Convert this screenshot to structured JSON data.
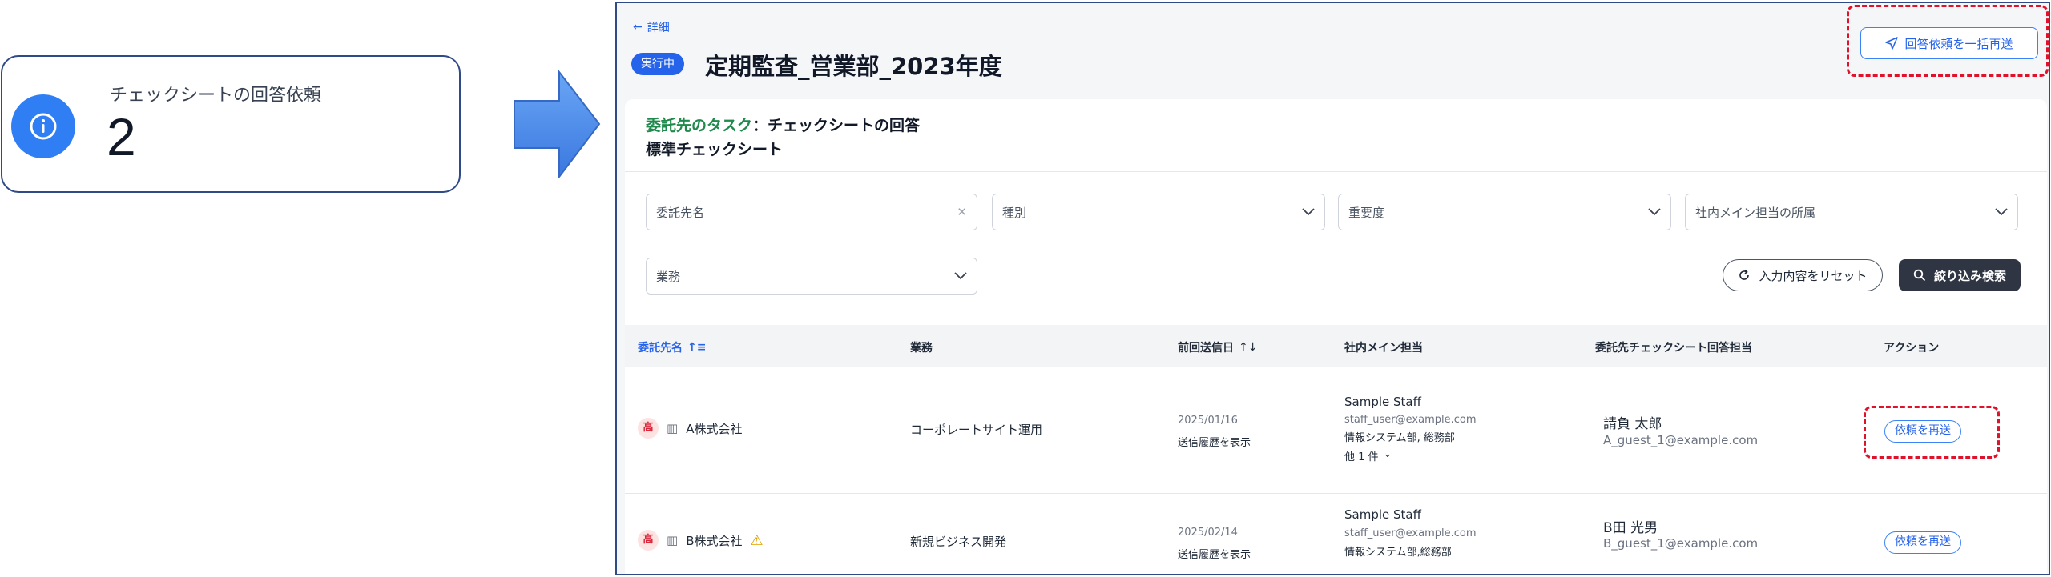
{
  "notice": {
    "label": "チェックシートの回答依頼",
    "count": "2",
    "icon": "info-icon"
  },
  "header": {
    "back_label": "詳細",
    "status": "実行中",
    "title": "定期監査_営業部_2023年度",
    "bulk_resend_label": "回答依頼を一括再送"
  },
  "task": {
    "prefix": "委託先のタスク",
    "separator": "：",
    "name": "チェックシートの回答",
    "checksheet": "標準チェックシート"
  },
  "filters": {
    "vendor_name": "委託先名",
    "type": "種別",
    "importance": "重要度",
    "department": "社内メイン担当の所属",
    "business": "業務"
  },
  "actions": {
    "reset_label": "入力内容をリセット",
    "search_label": "絞り込み検索"
  },
  "table": {
    "headers": {
      "vendor": "委託先名",
      "business": "業務",
      "last_sent": "前回送信日",
      "main_staff": "社内メイン担当",
      "respondent": "委託先チェックシート回答担当",
      "action": "アクション"
    },
    "rows": [
      {
        "priority": "高",
        "vendor": "A株式会社",
        "business": "コーポレートサイト運用",
        "last_sent": "2025/01/16",
        "history_link": "送信履歴を表示",
        "staff_name": "Sample Staff",
        "staff_email": "staff_user@example.com",
        "staff_dept": "情報システム部, 総務部",
        "staff_more": "他 1 件",
        "respondent_name": "請負 太郎",
        "respondent_email": "A_guest_1@example.com",
        "action_label": "依頼を再送"
      },
      {
        "priority": "高",
        "vendor": "B株式会社",
        "business": "新規ビジネス開発",
        "last_sent": "2025/02/14",
        "history_link": "送信履歴を表示",
        "staff_name": "Sample Staff",
        "staff_email": "staff_user@example.com",
        "staff_dept": "情報システム部,総務部",
        "respondent_name": "B田 光男",
        "respondent_email": "B_guest_1@example.com",
        "action_label": "依頼を再送"
      }
    ]
  },
  "colors": {
    "accent": "#2563eb",
    "highlight": "#e0112b",
    "task_green": "#1f8a4c",
    "priority_red": "#d9263a"
  }
}
